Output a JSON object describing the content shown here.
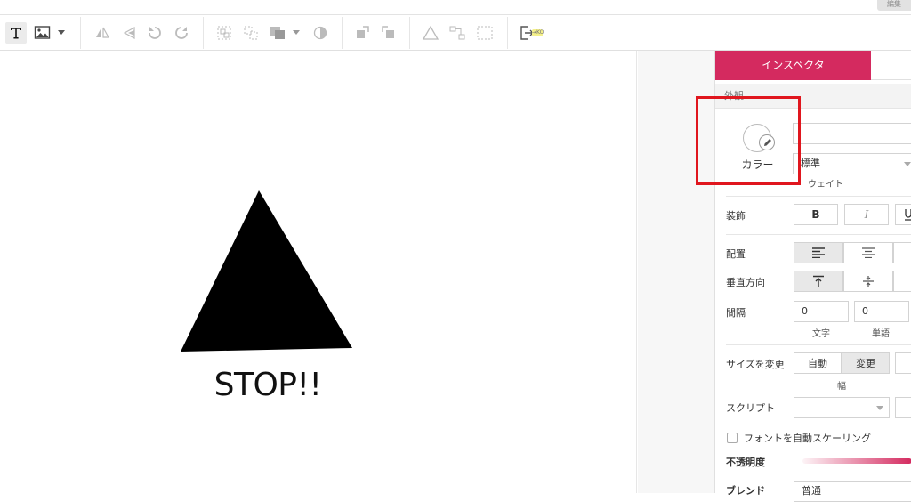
{
  "topbar": {
    "corner_label": "編集"
  },
  "toolbar": {
    "active_tool": "text",
    "badge": "⇥KO"
  },
  "canvas": {
    "shape": "triangle",
    "shape_color": "#000000",
    "text": "STOP!!"
  },
  "inspector": {
    "tab_label": "インスペクタ",
    "accent_color": "#d42a5f",
    "section_title": "外観",
    "color_label": "カラー",
    "font_size_value": "",
    "weight_value": "標準",
    "weight_caption": "ウェイト",
    "decoration_label": "装飾",
    "bold_label": "B",
    "italic_label": "I",
    "align_label": "配置",
    "valign_label": "垂直方向",
    "spacing_label": "間隔",
    "char_spacing": "0",
    "char_caption": "文字",
    "word_spacing": "0",
    "word_caption": "単語",
    "resize_label": "サイズを変更",
    "resize_auto": "自動",
    "resize_change": "変更",
    "width_caption": "幅",
    "script_label": "スクリプト",
    "autoscale_label": "フォントを自動スケーリング",
    "opacity_label": "不透明度",
    "blend_label": "ブレンド",
    "blend_value": "普通"
  }
}
